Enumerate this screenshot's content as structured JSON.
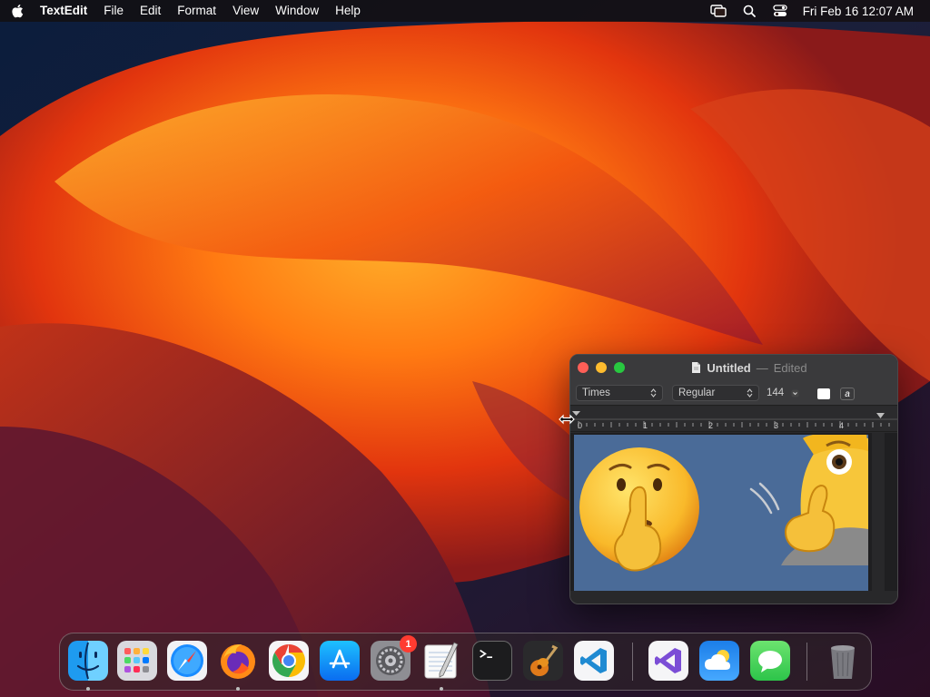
{
  "menubar": {
    "app_name": "TextEdit",
    "items": [
      "File",
      "Edit",
      "Format",
      "View",
      "Window",
      "Help"
    ],
    "clock": "Fri Feb 16  12:07 AM",
    "status_icons": [
      "screen-mirroring-icon",
      "search-icon",
      "control-center-icon"
    ]
  },
  "window": {
    "title": "Untitled",
    "title_separator": "—",
    "edited_label": "Edited",
    "toolbar": {
      "font_family": "Times",
      "typeface": "Regular",
      "font_size": "144",
      "style_button": "a"
    },
    "ruler": {
      "ticks": [
        "0",
        "1",
        "2",
        "3",
        "4"
      ]
    },
    "document_image": "shushing-face-emoji-and-person-emoji"
  },
  "dock": {
    "apps": [
      {
        "name": "Finder",
        "icon": "finder-icon",
        "running": true
      },
      {
        "name": "Launchpad",
        "icon": "launchpad-icon",
        "running": false
      },
      {
        "name": "Safari",
        "icon": "safari-icon",
        "running": false
      },
      {
        "name": "Firefox",
        "icon": "firefox-icon",
        "running": true
      },
      {
        "name": "Google Chrome",
        "icon": "chrome-icon",
        "running": false
      },
      {
        "name": "App Store",
        "icon": "app-store-icon",
        "running": false
      },
      {
        "name": "System Settings",
        "icon": "system-settings-icon",
        "running": false,
        "badge": "1"
      },
      {
        "name": "TextEdit",
        "icon": "textedit-icon",
        "running": true
      },
      {
        "name": "Terminal",
        "icon": "terminal-icon",
        "running": false
      },
      {
        "name": "GarageBand",
        "icon": "garageband-icon",
        "running": false
      },
      {
        "name": "Visual Studio Code",
        "icon": "vscode-icon",
        "running": false
      },
      {
        "name": "Visual Studio",
        "icon": "visual-studio-icon",
        "running": false
      },
      {
        "name": "Weather",
        "icon": "weather-icon",
        "running": false
      },
      {
        "name": "Messages",
        "icon": "messages-icon",
        "running": false
      },
      {
        "name": "Trash",
        "icon": "trash-icon",
        "running": false
      }
    ],
    "colors": {
      "accent": "#007aff",
      "badge": "#ff3b30"
    }
  }
}
